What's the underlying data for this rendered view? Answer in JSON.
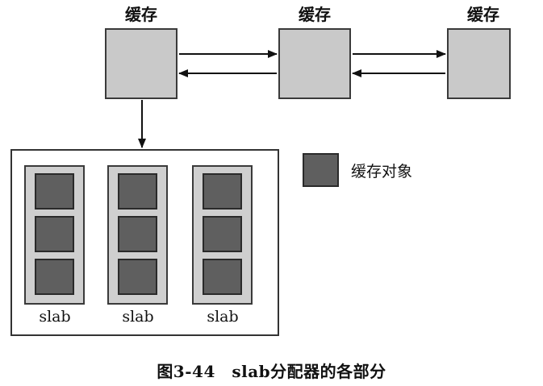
{
  "caches": [
    {
      "title": "缓存"
    },
    {
      "title": "缓存"
    },
    {
      "title": "缓存"
    }
  ],
  "slabs": [
    {
      "label": "slab",
      "object_count": 3
    },
    {
      "label": "slab",
      "object_count": 3
    },
    {
      "label": "slab",
      "object_count": 3
    }
  ],
  "legend": {
    "label": "缓存对象"
  },
  "caption": "图3-44　slab分配器的各部分",
  "colors": {
    "cache_fill": "#c9c9c9",
    "object_fill": "#5f5f5f",
    "border": "#333333"
  }
}
